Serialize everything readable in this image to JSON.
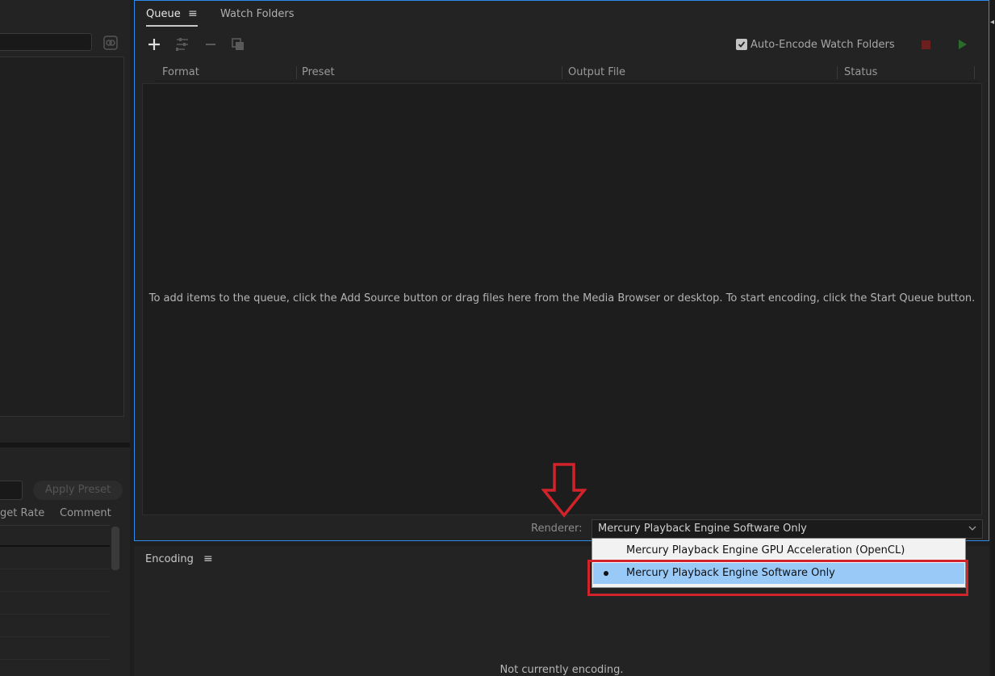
{
  "left_panel": {
    "apply_preset_label": "Apply Preset",
    "columns": [
      "get Rate",
      "Comment"
    ]
  },
  "queue_panel": {
    "tabs": [
      {
        "label": "Queue",
        "active": true
      },
      {
        "label": "Watch Folders",
        "active": false
      }
    ],
    "menu_glyph": "≡",
    "toolbar": {
      "icons": [
        "add-icon",
        "settings-icon",
        "remove-icon",
        "duplicate-icon"
      ],
      "auto_encode_label": "Auto-Encode Watch Folders",
      "auto_encode_checked": true
    },
    "columns": [
      "Format",
      "Preset",
      "Output File",
      "Status"
    ],
    "empty_hint": "To add items to the queue, click the Add Source button or drag files here from the Media Browser or desktop.  To start encoding, click the Start Queue button.",
    "renderer_label": "Renderer:",
    "renderer_value": "Mercury Playback Engine Software Only"
  },
  "renderer_options": [
    {
      "label": "Mercury Playback Engine GPU Acceleration (OpenCL)",
      "selected": false
    },
    {
      "label": "Mercury Playback Engine Software Only",
      "selected": true
    }
  ],
  "encoding_panel": {
    "title": "Encoding",
    "menu_glyph": "≡",
    "status": "Not currently encoding."
  },
  "colors": {
    "accent_border": "#2d8ceb",
    "highlight_red": "#d2232a",
    "selected_option": "#99c9f7"
  }
}
